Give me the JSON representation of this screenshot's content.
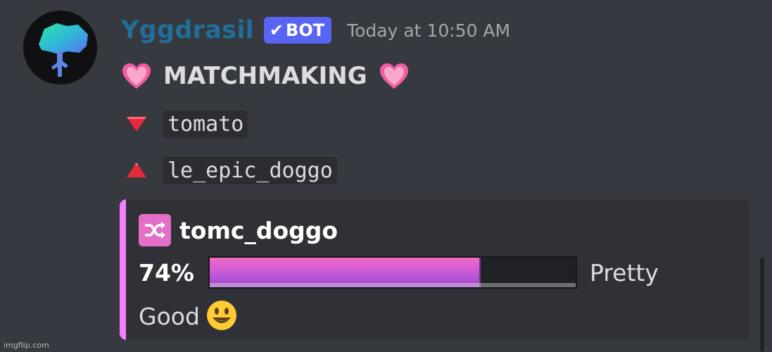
{
  "message": {
    "author": {
      "name": "Yggdrasil",
      "badge": "BOT",
      "badge_icon": "check-icon",
      "avatar_icon": "tree-icon",
      "name_color": "#1f6f9a"
    },
    "timestamp": "Today at 10:50 AM",
    "title": "MATCHMAKING",
    "title_icon": "pink-heart-icon",
    "users": [
      {
        "icon": "red-down-triangle-icon",
        "name": "tomato"
      },
      {
        "icon": "red-up-triangle-icon",
        "name": "le_epic_doggo"
      }
    ]
  },
  "embed": {
    "accent_color": "#f47fff",
    "icon": "shuffle-icon",
    "name": "tomc_doggo",
    "percent_label": "74%",
    "progress": 0.74,
    "verdict_line1": "Pretty",
    "verdict_line2": "Good",
    "verdict_icon": "smiley-icon"
  },
  "watermark": "imgflip.com"
}
